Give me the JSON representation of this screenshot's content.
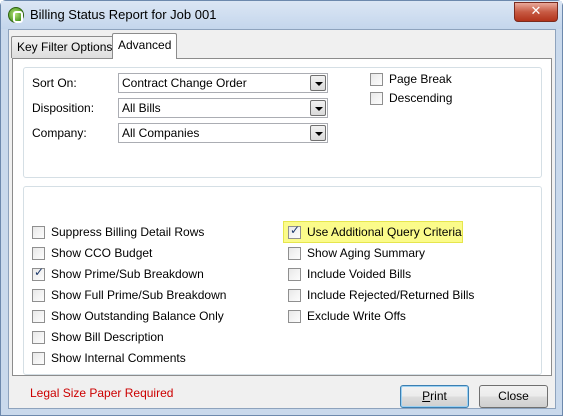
{
  "window": {
    "title": "Billing Status Report for Job 001",
    "close_glyph": "✕"
  },
  "tabs": [
    {
      "label": "Key Filter Options",
      "active": false
    },
    {
      "label": "Advanced",
      "active": true
    }
  ],
  "sort_group": {
    "sort_on": {
      "label": "Sort On:",
      "value": "Contract Change Order"
    },
    "disposition": {
      "label": "Disposition:",
      "value": "All Bills"
    },
    "company": {
      "label": "Company:",
      "value": "All Companies"
    },
    "page_break": {
      "label": "Page Break",
      "checked": false
    },
    "descending": {
      "label": "Descending",
      "checked": false
    }
  },
  "options_left": [
    {
      "label": "Suppress Billing Detail Rows",
      "checked": false
    },
    {
      "label": "Show CCO Budget",
      "checked": false
    },
    {
      "label": "Show Prime/Sub Breakdown",
      "checked": true
    },
    {
      "label": "Show Full Prime/Sub Breakdown",
      "checked": false
    },
    {
      "label": "Show Outstanding Balance Only",
      "checked": false
    },
    {
      "label": "Show Bill Description",
      "checked": false
    },
    {
      "label": "Show Internal Comments",
      "checked": false
    }
  ],
  "options_right": [
    {
      "label": "Use Additional Query Criteria",
      "checked": true,
      "highlighted": true
    },
    {
      "label": "Show Aging Summary",
      "checked": false
    },
    {
      "label": "Include Voided Bills",
      "checked": false
    },
    {
      "label": "Include Rejected/Returned Bills",
      "checked": false
    },
    {
      "label": "Exclude Write Offs",
      "checked": false
    }
  ],
  "notice": "Legal Size Paper Required",
  "buttons": {
    "print_first": "P",
    "print_rest": "rint",
    "close": "Close"
  },
  "colors": {
    "highlight": "#fbfb8a",
    "notice": "#cc0000",
    "title_bar": "#c4d6ec"
  },
  "check_glyph": "✓"
}
